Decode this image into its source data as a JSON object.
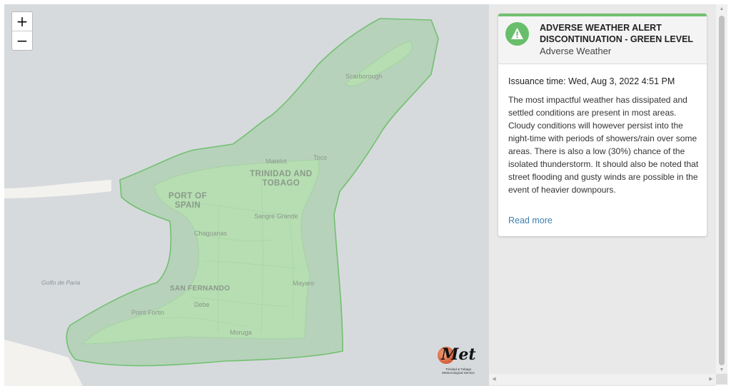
{
  "map": {
    "zoom_in": "+",
    "zoom_out": "−",
    "labels": {
      "scarborough": "Scarborough",
      "matelot": "Matelot",
      "toco": "Toco",
      "country_line1": "TRINIDAD AND",
      "country_line2": "TOBAGO",
      "port_line1": "PORT OF",
      "port_line2": "SPAIN",
      "sangre_grande": "Sangre Grande",
      "chaguanas": "Chaguanas",
      "golfo": "Golfo de Paria",
      "san_fernando": "SAN FERNANDO",
      "mayaro": "Mayaro",
      "point_fortin": "Point Fortin",
      "debe": "Debe",
      "moruga": "Moruga"
    },
    "alert_zone_color": "#72c070",
    "logo_text": "Met",
    "logo_caption": "Trinidad & Tobago Meteorological Service"
  },
  "alert": {
    "title": "ADVERSE WEATHER ALERT DISCONTINUATION - GREEN LEVEL",
    "subtitle": "Adverse Weather",
    "icon": "warning-triangle-icon",
    "level_color": "#72c070",
    "issuance": "Issuance time: Wed, Aug 3, 2022 4:51 PM",
    "body": "The most impactful weather has dissipated and settled conditions are present in most areas. Cloudy conditions will however persist into the night-time with periods of showers/rain over some areas. There is also a low (30%) chance of the isolated thunderstorm. It should also be noted that street flooding and gusty winds are possible in the event of heavier downpours.",
    "read_more": "Read more"
  },
  "scrollbars": {
    "up": "▲",
    "down": "▼",
    "left": "◀",
    "right": "▶"
  }
}
